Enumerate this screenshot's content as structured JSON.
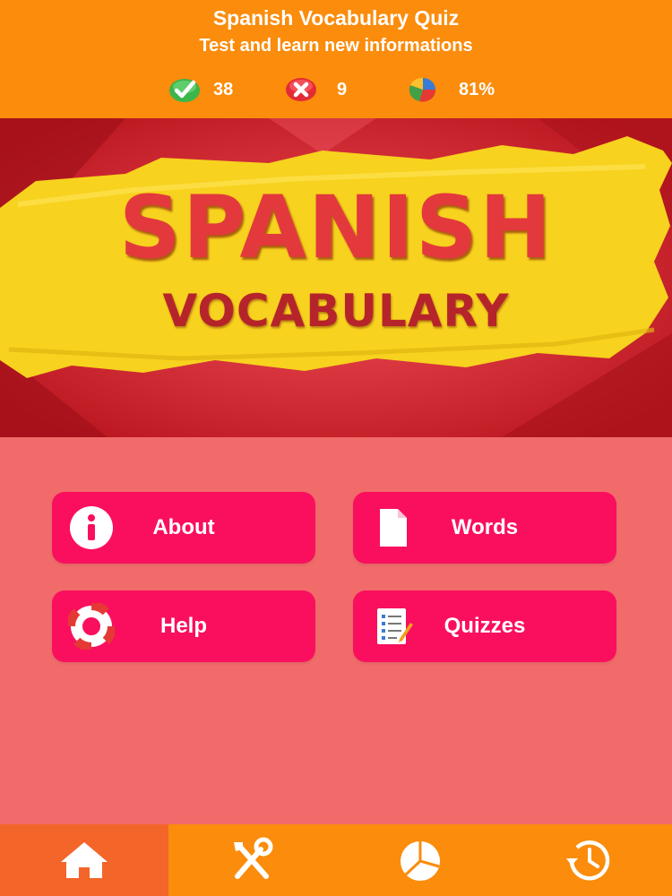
{
  "header": {
    "title": "Spanish Vocabulary Quiz",
    "subtitle": "Test and learn new informations",
    "stats": {
      "correct": "38",
      "wrong": "9",
      "percent": "81%"
    }
  },
  "banner": {
    "line1": "SPANISH",
    "line2": "VOCABULARY"
  },
  "menu": {
    "about": "About",
    "words": "Words",
    "help": "Help",
    "quizzes": "Quizzes"
  },
  "tabs": {
    "active": "home",
    "icons": [
      "home-icon",
      "tools-icon",
      "pie-chart-icon",
      "history-icon"
    ]
  },
  "colors": {
    "header": "#fb8c0c",
    "background": "#f26b6b",
    "button": "#fa0f5e",
    "active_tab": "#f4652a"
  }
}
